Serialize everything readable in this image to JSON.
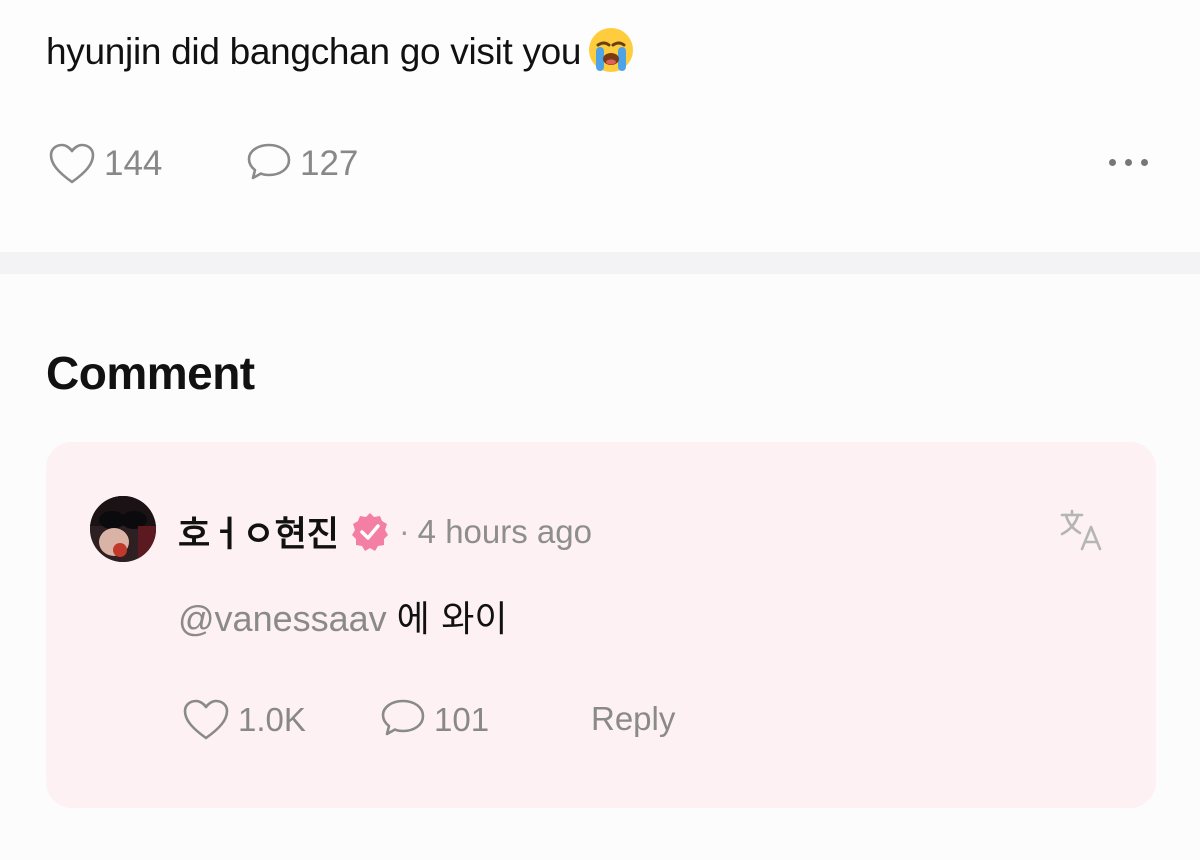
{
  "post": {
    "text": "hyunjin did bangchan go visit you",
    "emoji": "loudly-crying-face-emoji",
    "likes": "144",
    "comments": "127"
  },
  "comment_section": {
    "heading": "Comment"
  },
  "comment": {
    "author": "호ㅓㅇ현진",
    "separator": "·",
    "timestamp": "4 hours ago",
    "mention": "@vanessaav",
    "text": "에 와이",
    "likes": "1.0K",
    "replies": "101",
    "reply_label": "Reply"
  },
  "colors": {
    "card_background": "#fdf1f4",
    "badge": "#f47fa4",
    "muted_text": "#888888"
  }
}
